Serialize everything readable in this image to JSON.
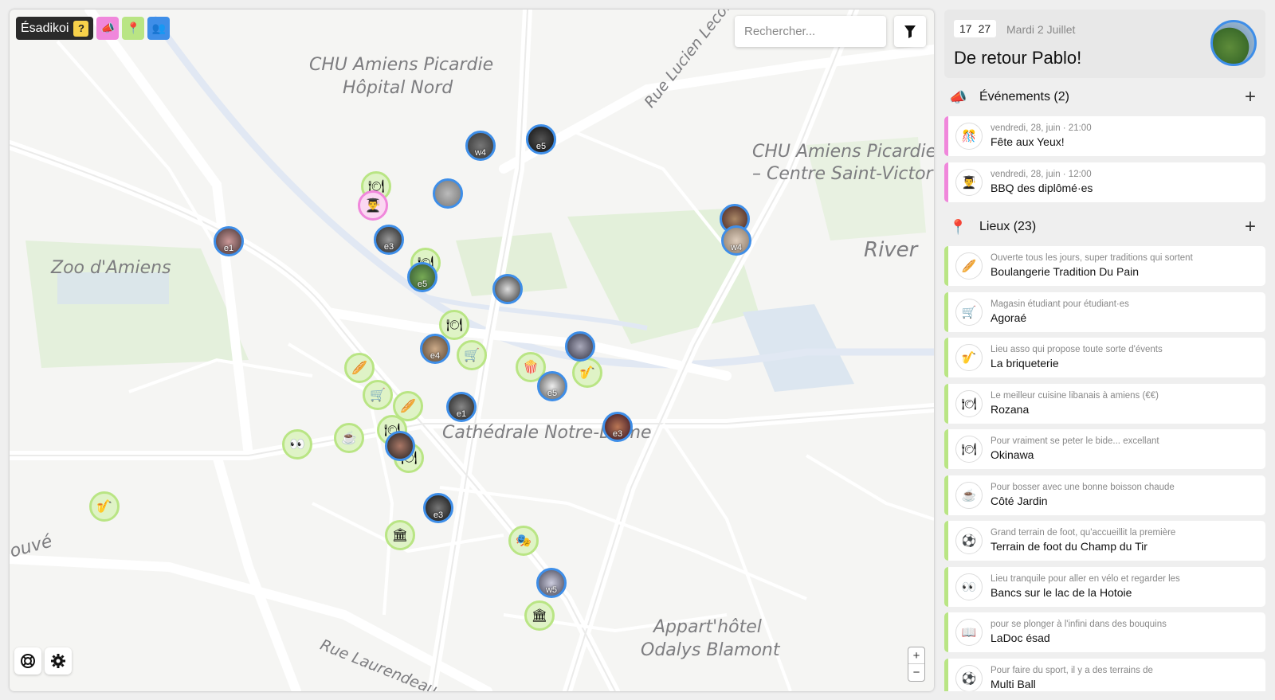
{
  "app": {
    "brand": "Ésadikoi",
    "help_label": "?",
    "layer_icons": [
      "megaphone-icon",
      "pin-icon",
      "people-icon"
    ],
    "colors": {
      "events": "#f087db",
      "places": "#b9e584",
      "people": "#3e8ee8"
    }
  },
  "search": {
    "placeholder": "Rechercher...",
    "value": ""
  },
  "map": {
    "labels": [
      "CHU Amiens Picardie",
      "Hôpital Nord",
      "Zoo d'Amiens",
      "CHU Amiens Picardie",
      "– Centre Saint-Victor",
      "Cathédrale Notre-Dame",
      "Appart'hôtel",
      "Odalys Blamont",
      "Rue Lucien Lecointe",
      "Rue Laurendeau",
      "River",
      "ouvé"
    ],
    "zoom_in": "+",
    "zoom_out": "−",
    "person_tags": [
      "w4",
      "e5",
      "e1",
      "e3",
      "e5",
      "e4",
      "w4",
      "e5",
      "e1",
      "e5",
      "e3",
      "e3",
      "w5",
      "e3"
    ]
  },
  "header": {
    "hour": "17",
    "minute": "27",
    "date": "Mardi 2 Juillet",
    "greeting": "De retour Pablo!"
  },
  "events": {
    "title": "Événements (2)",
    "add_label": "+",
    "items": [
      {
        "meta": "vendredi, 28, juin · 21:00",
        "title": "Fête aux Yeux!",
        "icon": "🎊"
      },
      {
        "meta": "vendredi, 28, juin · 12:00",
        "title": "BBQ des diplômé·es",
        "icon": "👨‍🎓"
      }
    ]
  },
  "places": {
    "title": "Lieux (23)",
    "add_label": "+",
    "items": [
      {
        "desc": "Ouverte tous les jours, super traditions qui sortent",
        "title": "Boulangerie Tradition Du Pain",
        "icon": "🥖"
      },
      {
        "desc": "Magasin étudiant pour étudiant·es",
        "title": "Agoraé",
        "icon": "🛒"
      },
      {
        "desc": "Lieu asso qui propose toute sorte d'évents",
        "title": "La briqueterie",
        "icon": "🎷"
      },
      {
        "desc": "Le meilleur cuisine libanais à amiens (€€)",
        "title": "Rozana",
        "icon": "🍽"
      },
      {
        "desc": "Pour vraiment se peter le bide... excellant",
        "title": "Okinawa",
        "icon": "🍽"
      },
      {
        "desc": "Pour bosser avec une bonne boisson chaude",
        "title": "Côté Jardin",
        "icon": "☕"
      },
      {
        "desc": "Grand terrain de foot, qu'accueillit la première",
        "title": "Terrain de foot du Champ du Tir",
        "icon": "⚽"
      },
      {
        "desc": "Lieu tranquile pour aller en vélo et regarder les",
        "title": "Bancs sur le lac de la Hotoie",
        "icon": "👀"
      },
      {
        "desc": "pour se plonger à l'infini dans des bouquins",
        "title": "LaDoc ésad",
        "icon": "📖"
      },
      {
        "desc": "Pour faire du sport, il y a des terrains de",
        "title": "Multi Ball",
        "icon": "⚽"
      }
    ]
  }
}
